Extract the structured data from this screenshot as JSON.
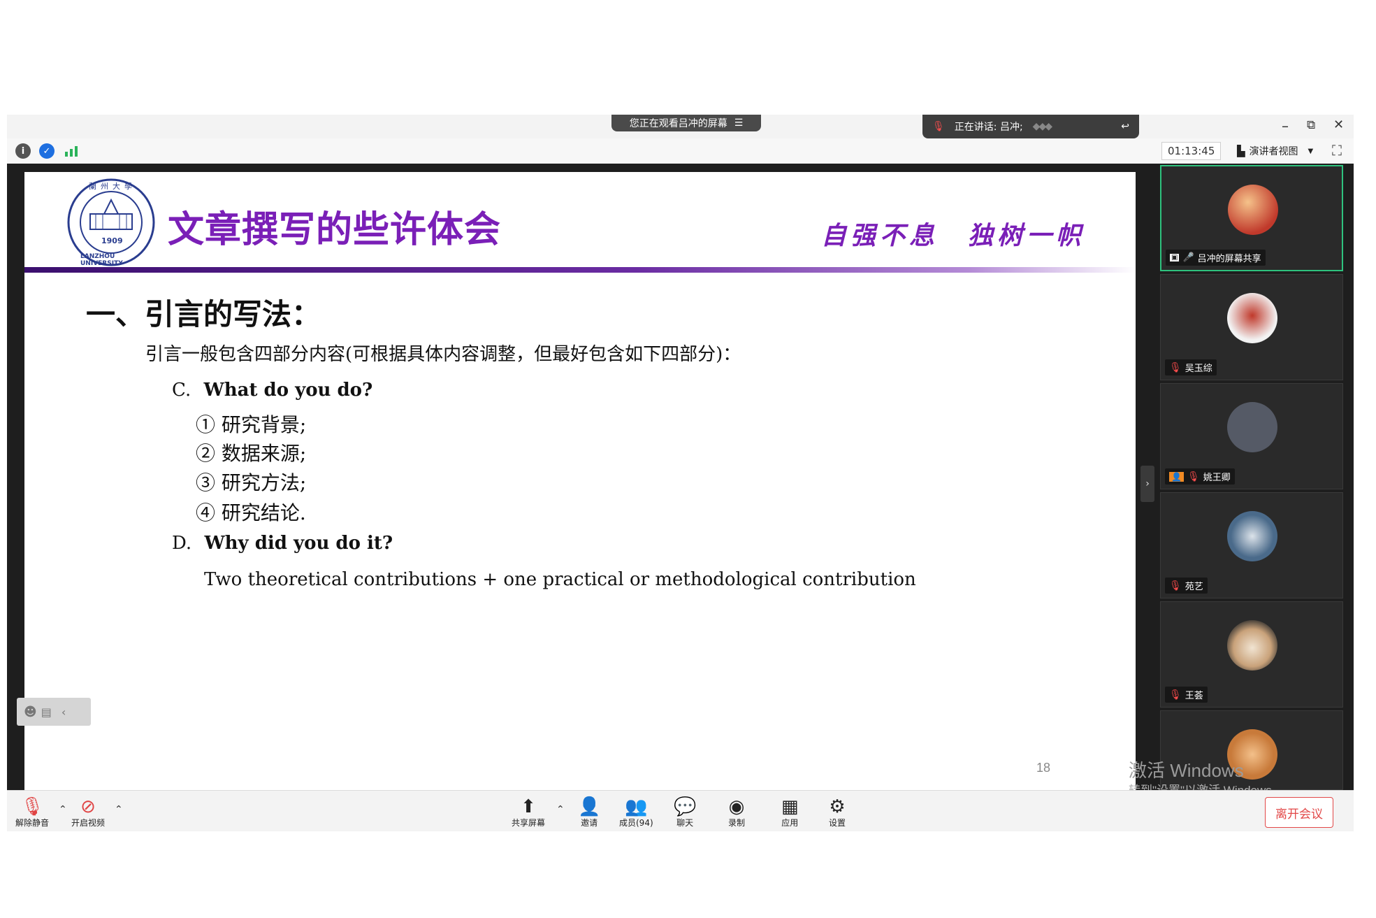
{
  "banner": {
    "viewing_text": "您正在观看吕冲的屏幕",
    "speaking_text": "正在讲话: 吕冲;"
  },
  "window": {
    "minimize_icon": "–",
    "restore_icon": "⧉",
    "close_icon": "✕"
  },
  "top_toolbar": {
    "timer": "01:13:45",
    "view_label": "演讲者视图"
  },
  "slide": {
    "title": "文章撰写的些许体会",
    "motto": "自强不息　独树一帜",
    "logo_text_top": "蘭州大學",
    "logo_year": "1909",
    "logo_text_bottom": "LANZHOU UNIVERSITY",
    "section_heading": "一、引言的写法：",
    "intro": "引言一般包含四部分内容(可根据具体内容调整，但最好包含如下四部分)：",
    "part_c_letter": "C.",
    "part_c_title": "What do you do?",
    "items": [
      "① 研究背景;",
      "② 数据来源;",
      "③ 研究方法;",
      "④ 研究结论."
    ],
    "part_d_letter": "D.",
    "part_d_title": "Why did you do it?",
    "part_d_body": "Two theoretical contributions + one practical or methodological contribution",
    "page_number": "18"
  },
  "participants": [
    {
      "label": "吕冲的屏幕共享",
      "active": true,
      "avatar_color": "#c0392b"
    },
    {
      "label": "吴玉综",
      "active": false,
      "avatar_color": "#e8e8e8"
    },
    {
      "label": "姚王卿",
      "active": false,
      "avatar_color": "#555a66"
    },
    {
      "label": "苑艺",
      "active": false,
      "avatar_color": "#4a6a8a"
    },
    {
      "label": "王荟",
      "active": false,
      "avatar_color": "#c9a27a"
    },
    {
      "label": "",
      "active": false,
      "avatar_color": "#c87a3a"
    }
  ],
  "watermark": {
    "line1": "激活 Windows",
    "line2": "转到\"设置\"以激活 Windows。"
  },
  "controls": {
    "mute": "解除静音",
    "video": "开启视频",
    "share": "共享屏幕",
    "invite": "邀请",
    "members": "成员(94)",
    "chat": "聊天",
    "record": "录制",
    "apps": "应用",
    "settings": "设置",
    "leave": "离开会议"
  },
  "colors": {
    "slide_accent": "#7a1fb7",
    "leave": "#e24848",
    "active_tile": "#2ec27e"
  }
}
